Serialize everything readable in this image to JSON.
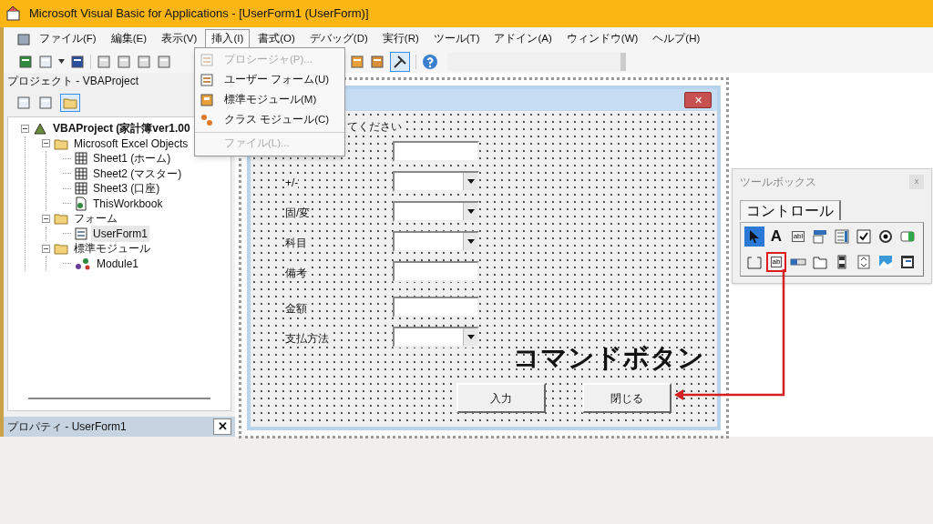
{
  "window": {
    "title": "Microsoft Visual Basic for Applications - [UserForm1 (UserForm)]"
  },
  "menu_bar": [
    {
      "label": "ファイル(F)",
      "selected": false
    },
    {
      "label": "編集(E)",
      "selected": false
    },
    {
      "label": "表示(V)",
      "selected": false
    },
    {
      "label": "挿入(I)",
      "selected": true
    },
    {
      "label": "書式(O)",
      "selected": false
    },
    {
      "label": "デバッグ(D)",
      "selected": false
    },
    {
      "label": "実行(R)",
      "selected": false
    },
    {
      "label": "ツール(T)",
      "selected": false
    },
    {
      "label": "アドイン(A)",
      "selected": false
    },
    {
      "label": "ウィンドウ(W)",
      "selected": false
    },
    {
      "label": "ヘルプ(H)",
      "selected": false
    }
  ],
  "insert_menu": [
    {
      "label": "プロシージャ(P)...",
      "disabled": true,
      "kind": "procedure"
    },
    {
      "label": "ユーザー フォーム(U)",
      "disabled": false,
      "kind": "form"
    },
    {
      "label": "標準モジュール(M)",
      "disabled": false,
      "kind": "module"
    },
    {
      "label": "クラス モジュール(C)",
      "disabled": false,
      "kind": "class"
    },
    {
      "label": "ファイル(L)...",
      "disabled": true,
      "kind": "file"
    }
  ],
  "project_panel": {
    "title": "プロジェクト - VBAProject",
    "tree": [
      {
        "label": "VBAProject (家計簿ver1.00",
        "kind": "project",
        "expanded": true,
        "selected": false,
        "children": [
          {
            "label": "Microsoft Excel Objects",
            "kind": "folder",
            "expanded": true,
            "selected": false,
            "children": [
              {
                "label": "Sheet1 (ホーム)",
                "kind": "sheet",
                "selected": false
              },
              {
                "label": "Sheet2 (マスター)",
                "kind": "sheet",
                "selected": false
              },
              {
                "label": "Sheet3 (口座)",
                "kind": "sheet",
                "selected": false
              },
              {
                "label": "ThisWorkbook",
                "kind": "workbook",
                "selected": false
              }
            ]
          },
          {
            "label": "フォーム",
            "kind": "folder",
            "expanded": true,
            "selected": false,
            "children": [
              {
                "label": "UserForm1",
                "kind": "form",
                "selected": true
              }
            ]
          },
          {
            "label": "標準モジュール",
            "kind": "folder",
            "expanded": true,
            "selected": false,
            "children": [
              {
                "label": "Module1",
                "kind": "module",
                "selected": false
              }
            ]
          }
        ]
      }
    ]
  },
  "properties_panel": {
    "title": "プロパティ - UserForm1",
    "close": "✕"
  },
  "user_form": {
    "close": "✕",
    "caption": "てください",
    "rows": [
      {
        "kind": "text"
      },
      {
        "label": "+/-",
        "kind": "combo"
      },
      {
        "label": "固/変",
        "kind": "combo"
      },
      {
        "label": "科目",
        "kind": "combo"
      },
      {
        "label": "備考",
        "kind": "text"
      },
      {
        "label": "金額",
        "kind": "text"
      },
      {
        "label": "支払方法",
        "kind": "combo"
      }
    ],
    "buttons": [
      "入力",
      "閉じる"
    ]
  },
  "toolbox": {
    "title": "ツールボックス",
    "close": "x",
    "tab": "コントロール",
    "controls": [
      {
        "kind": "pointer",
        "selected": true,
        "highlighted": false
      },
      {
        "kind": "label",
        "label": "A",
        "selected": false,
        "highlighted": false
      },
      {
        "kind": "textbox",
        "label": "abl",
        "selected": false,
        "highlighted": false
      },
      {
        "kind": "combobox",
        "selected": false,
        "highlighted": false
      },
      {
        "kind": "listbox",
        "selected": false,
        "highlighted": false
      },
      {
        "kind": "checkbox",
        "selected": false,
        "highlighted": false
      },
      {
        "kind": "option",
        "selected": false,
        "highlighted": false
      },
      {
        "kind": "toggle",
        "selected": false,
        "highlighted": false
      },
      {
        "kind": "frame",
        "selected": false,
        "highlighted": false
      },
      {
        "kind": "command",
        "label": "ab",
        "selected": false,
        "highlighted": true
      },
      {
        "kind": "tabstrip",
        "selected": false,
        "highlighted": false
      },
      {
        "kind": "multipage",
        "selected": false,
        "highlighted": false
      },
      {
        "kind": "scrollbar",
        "selected": false,
        "highlighted": false
      },
      {
        "kind": "spin",
        "selected": false,
        "highlighted": false
      },
      {
        "kind": "image",
        "selected": false,
        "highlighted": false
      },
      {
        "kind": "refedit",
        "selected": false,
        "highlighted": false
      }
    ]
  },
  "annotation": {
    "text": "コマンドボタン"
  }
}
